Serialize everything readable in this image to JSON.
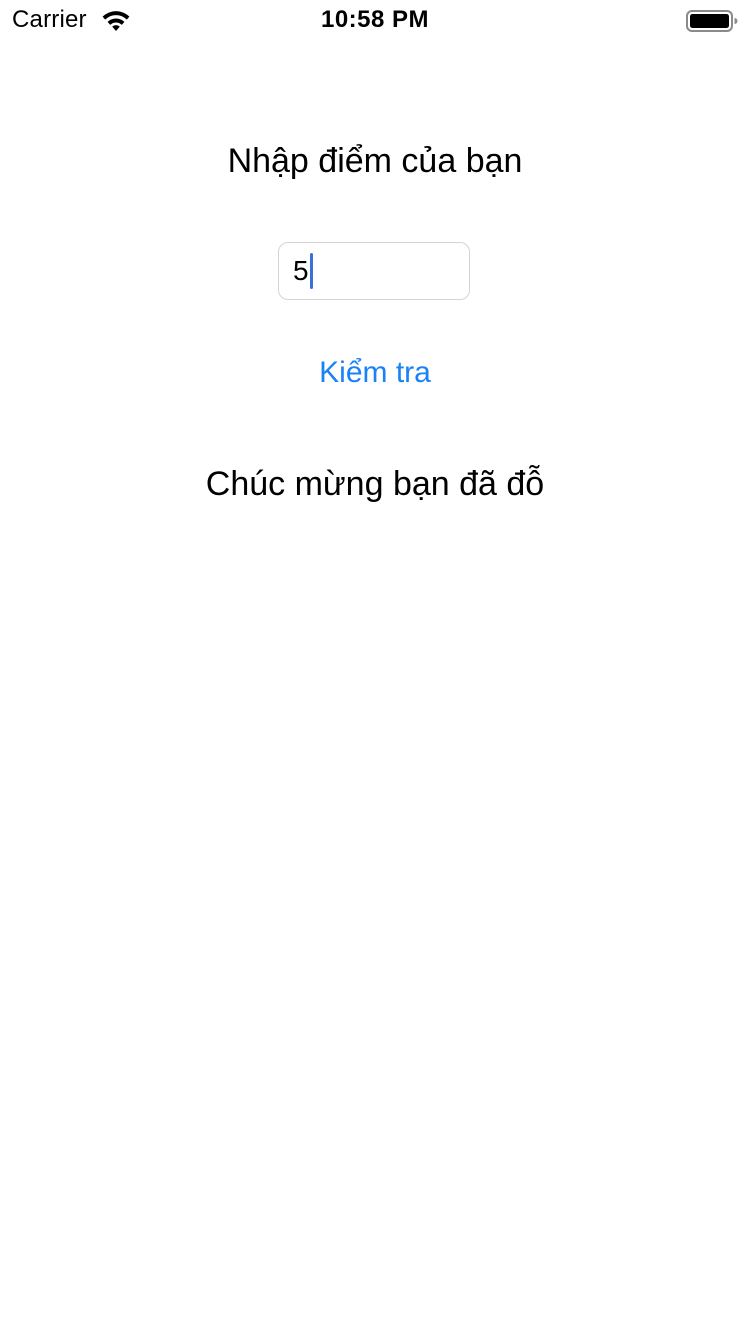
{
  "status_bar": {
    "carrier": "Carrier",
    "time": "10:58 PM",
    "wifi_icon": "wifi-icon",
    "battery_icon": "battery-full-icon"
  },
  "main": {
    "prompt": "Nhập điểm của bạn",
    "score_input": {
      "value": "5",
      "placeholder": ""
    },
    "check_button_label": "Kiểm tra",
    "result": "Chúc mừng bạn đã đỗ"
  },
  "colors": {
    "accent": "#1a82f7",
    "caret": "#3a6fdb",
    "text": "#000000",
    "background": "#ffffff"
  }
}
